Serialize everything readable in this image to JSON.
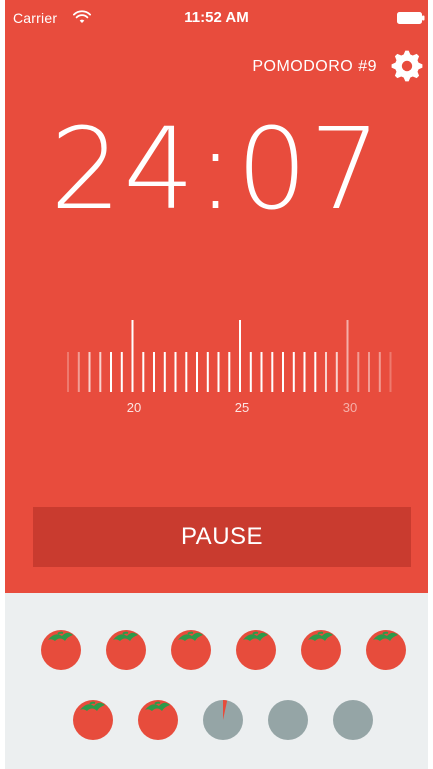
{
  "status_bar": {
    "carrier": "Carrier",
    "time": "11:52 AM",
    "wifi_icon": "wifi-icon",
    "battery_icon": "battery-icon"
  },
  "header": {
    "session_label": "POMODORO #9",
    "settings_icon": "gear-icon"
  },
  "timer": {
    "display": "24:07"
  },
  "ruler": {
    "labels": [
      "20",
      "25",
      "30"
    ]
  },
  "actions": {
    "pause_label": "PAUSE"
  },
  "history": {
    "completed_count": 8,
    "in_progress_count": 1,
    "pending_count": 2
  },
  "colors": {
    "accent": "#e84c3d",
    "button": "#c93b2f",
    "tomato": "#e74c3c",
    "leaf": "#2e9a4a",
    "pending": "#95a5a6",
    "panel": "#eceff0"
  }
}
